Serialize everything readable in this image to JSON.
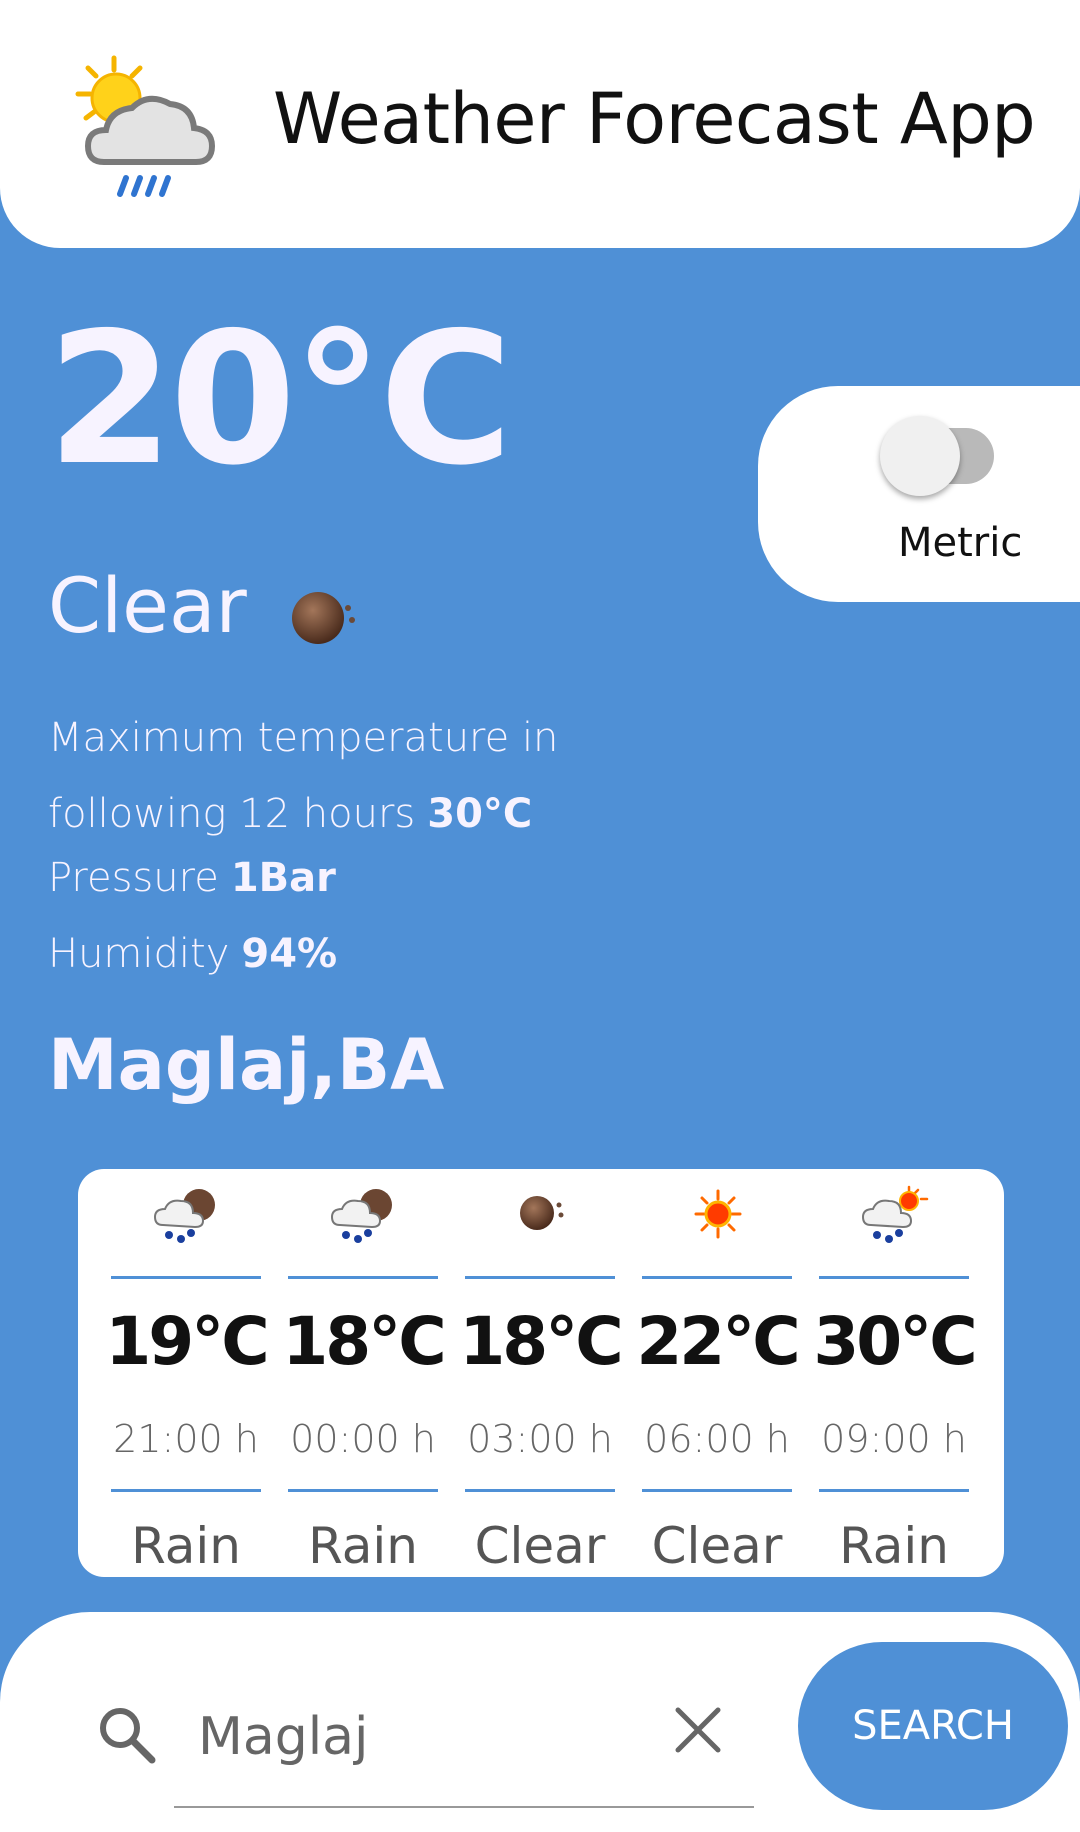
{
  "header": {
    "title": "Weather Forecast App",
    "logo_icon": "sun-cloud-rain-icon"
  },
  "current": {
    "temperature": "20°C",
    "condition": "Clear",
    "condition_icon": "clear-night-moon-icon",
    "max_label": "Maximum temperature in",
    "max_label_2": "following 12 hours",
    "max_value": "30°C",
    "pressure_label": "Pressure",
    "pressure_value": "1Bar",
    "humidity_label": "Humidity",
    "humidity_value": "94%",
    "location": "Maglaj,BA"
  },
  "units": {
    "label": "Metric",
    "toggle_on": false
  },
  "forecast": [
    {
      "temp": "19°C",
      "time": "21:00 h",
      "desc": "Rain",
      "icon": "rain-night-icon"
    },
    {
      "temp": "18°C",
      "time": "00:00 h",
      "desc": "Rain",
      "icon": "rain-night-icon"
    },
    {
      "temp": "18°C",
      "time": "03:00 h",
      "desc": "Clear",
      "icon": "clear-night-moon-icon"
    },
    {
      "temp": "22°C",
      "time": "06:00 h",
      "desc": "Clear",
      "icon": "sun-icon"
    },
    {
      "temp": "30°C",
      "time": "09:00 h",
      "desc": "Rain",
      "icon": "rain-sun-icon"
    }
  ],
  "search": {
    "value": "Maglaj",
    "button_label": "SEARCH"
  },
  "colors": {
    "background": "#4f90d6",
    "card": "#ffffff",
    "accent_line": "#4f90d6"
  }
}
